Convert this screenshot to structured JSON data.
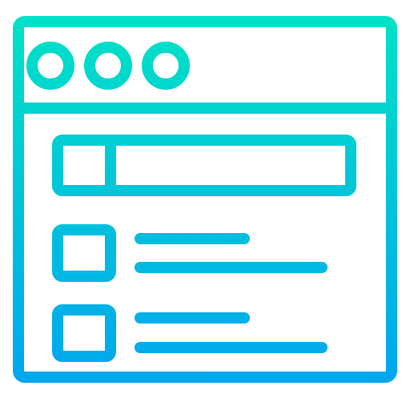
{
  "icon": {
    "name": "web-browser-list-layout-icon",
    "gradient": {
      "top_color": "#00E2C6",
      "bottom_color": "#00A6EE"
    },
    "window_buttons": [
      "window-dot-icon",
      "window-dot-icon",
      "window-dot-icon"
    ],
    "search_bar": {
      "name": "search-bar"
    },
    "list_items": [
      {
        "name": "list-item"
      },
      {
        "name": "list-item"
      }
    ]
  }
}
